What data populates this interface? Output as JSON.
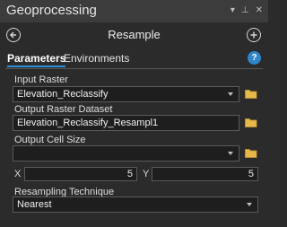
{
  "window": {
    "title": "Geoprocessing"
  },
  "title_controls": {
    "pin": "▾",
    "dock": "⊥",
    "close": "✕"
  },
  "tool": {
    "name": "Resample"
  },
  "tabs": [
    {
      "label": "Parameters",
      "active": true
    },
    {
      "label": "Environments",
      "active": false
    }
  ],
  "params": {
    "input_raster": {
      "label": "Input Raster",
      "value": "Elevation_Reclassify"
    },
    "output_raster": {
      "label": "Output Raster Dataset",
      "value": "Elevation_Reclassify_Resampl1"
    },
    "output_cell_size": {
      "label": "Output Cell Size",
      "value": ""
    },
    "x": {
      "label": "X",
      "value": "5"
    },
    "y": {
      "label": "Y",
      "value": "5"
    },
    "technique": {
      "label": "Resampling Technique",
      "value": "Nearest"
    }
  },
  "icons": {
    "back": "back-arrow-icon",
    "forward": "add-icon",
    "help": "help-icon",
    "folder": "folder-icon"
  },
  "colors": {
    "accent": "#2e90d9",
    "folder": "#e8b84a",
    "background": "#2b2b2b"
  }
}
